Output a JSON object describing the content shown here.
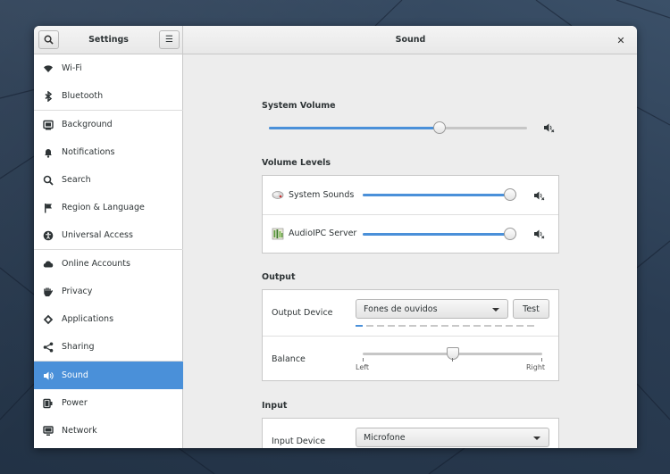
{
  "window": {
    "sidebar_title": "Settings",
    "page_title": "Sound",
    "close_glyph": "✕",
    "menu_glyph": "☰"
  },
  "sidebar": {
    "items": [
      {
        "label": "Wi-Fi",
        "icon": "wifi-icon"
      },
      {
        "label": "Bluetooth",
        "icon": "bluetooth-icon"
      },
      {
        "label": "Background",
        "icon": "background-icon"
      },
      {
        "label": "Notifications",
        "icon": "bell-icon"
      },
      {
        "label": "Search",
        "icon": "search-icon"
      },
      {
        "label": "Region & Language",
        "icon": "flag-icon"
      },
      {
        "label": "Universal Access",
        "icon": "accessibility-icon"
      },
      {
        "label": "Online Accounts",
        "icon": "cloud-icon"
      },
      {
        "label": "Privacy",
        "icon": "hand-icon"
      },
      {
        "label": "Applications",
        "icon": "applications-icon"
      },
      {
        "label": "Sharing",
        "icon": "share-icon"
      },
      {
        "label": "Sound",
        "icon": "speaker-icon",
        "active": true
      },
      {
        "label": "Power",
        "icon": "power-icon"
      },
      {
        "label": "Network",
        "icon": "network-icon"
      }
    ]
  },
  "sound": {
    "system_volume": {
      "title": "System Volume",
      "level": 0.66
    },
    "volume_levels": {
      "title": "Volume Levels",
      "apps": [
        {
          "name": "System Sounds",
          "level": 1.0,
          "icon": "system-sounds-icon"
        },
        {
          "name": "AudioIPC Server",
          "level": 1.0,
          "icon": "audioipc-icon"
        }
      ]
    },
    "output": {
      "title": "Output",
      "device_label": "Output Device",
      "device_value": "Fones de ouvidos",
      "test_label": "Test",
      "balance_label": "Balance",
      "balance_left": "Left",
      "balance_right": "Right",
      "balance_value": 0.5
    },
    "input": {
      "title": "Input",
      "device_label": "Input Device",
      "device_value": "Microfone"
    }
  },
  "colors": {
    "accent": "#4a90d9",
    "sidebar_bg": "#ffffff",
    "content_bg": "#ededed"
  }
}
